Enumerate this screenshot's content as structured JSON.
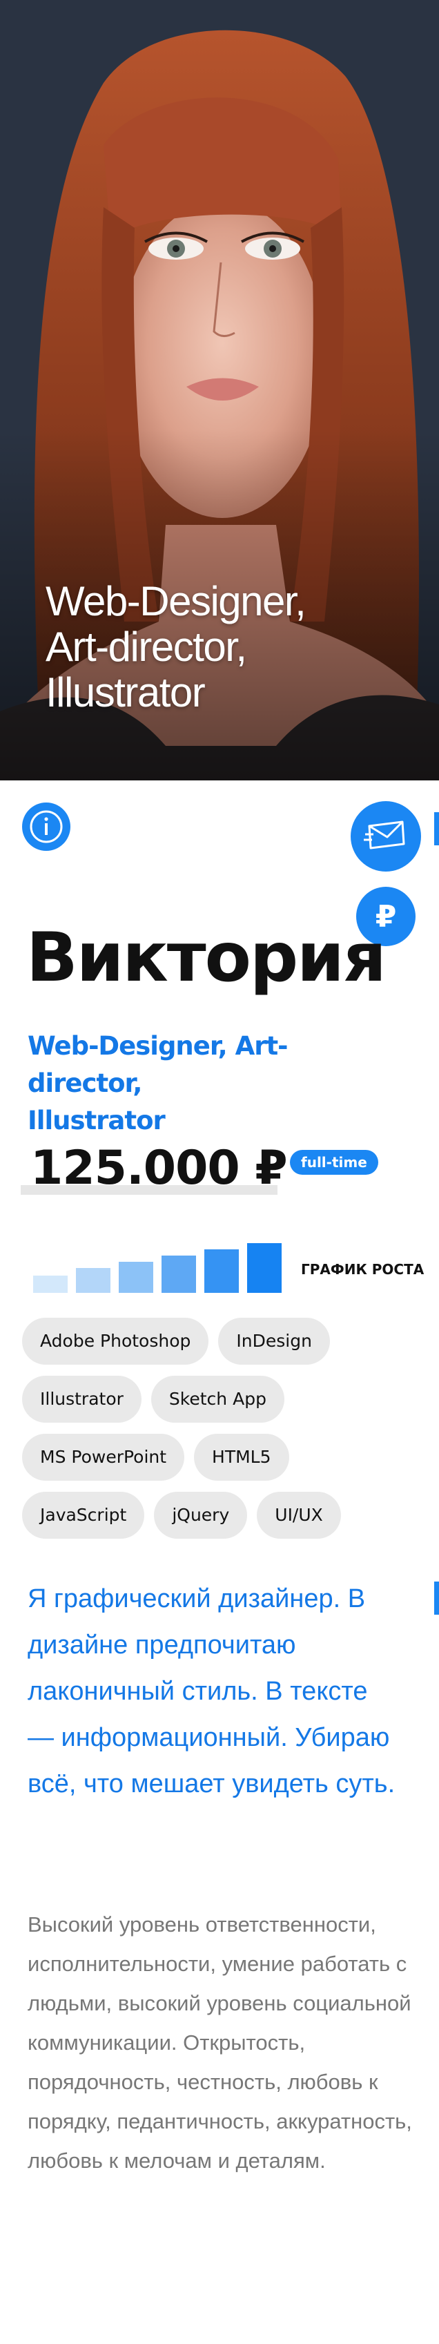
{
  "hero": {
    "title": "Web-Designer,\nArt-director,\nIllustrator"
  },
  "actions": {
    "info_icon": "info-icon",
    "mail_icon": "mail-icon",
    "ruble_icon": "ruble-icon",
    "ruble_glyph": "₽"
  },
  "profile": {
    "name": "Виктория",
    "subtitle": "Web-Designer, Art-director,\nIllustrator",
    "salary": "125.000 ₽",
    "employment_badge": "full-time",
    "growth_label": "ГРАФИК РОСТА"
  },
  "growth_chart": {
    "levels": [
      0.35,
      0.5,
      0.62,
      0.75,
      0.88,
      1.0
    ],
    "colors": [
      "#d3e8fb",
      "#b3d6f9",
      "#8cc2f7",
      "#5ea8f4",
      "#3593f3",
      "#1683f2"
    ]
  },
  "skills": [
    "Adobe Photoshop",
    "InDesign",
    "Illustrator",
    "Sketch App",
    "MS PowerPoint",
    "HTML5",
    "JavaScript",
    "jQuery",
    "UI/UX"
  ],
  "about": {
    "lead": "Я графический дизайнер. В дизайне предпочитаю лаконичный стиль. В тексте — информационный. Убираю всё, что мешает увидеть суть.",
    "details": "Высокий уровень ответственности, исполнительности, умение работать с людьми, высокий уровень социальной коммуникации. Открытость, порядочность, честность, любовь к порядку, педантичность, аккуратность, любовь к мелочам и деталям."
  },
  "colors": {
    "accent": "#1b87f3",
    "chip_bg": "#e9e9e9"
  }
}
